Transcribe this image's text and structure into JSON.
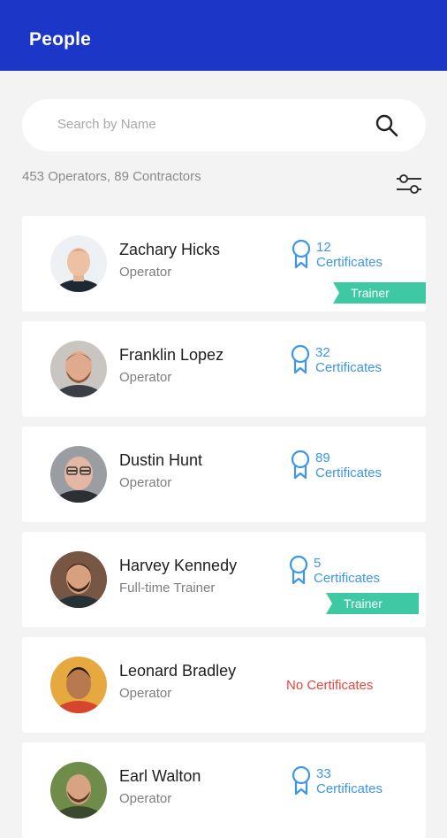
{
  "header": {
    "title": "People"
  },
  "search": {
    "placeholder": "Search by Name",
    "icon": "search-icon"
  },
  "summary": {
    "text": "453 Operators, 89 Contractors",
    "filter_icon": "filter-sliders-icon"
  },
  "colors": {
    "appbar": "#1c36c8",
    "certificate_blue": "#3d96ea",
    "no_cert_red": "#e8443a",
    "trainer_badge": "#3ec9a3"
  },
  "people": [
    {
      "name": "Zachary Hicks",
      "role": "Operator",
      "cert_count": "12",
      "cert_label": "Certificates",
      "badge": "Trainer"
    },
    {
      "name": "Franklin Lopez",
      "role": "Operator",
      "cert_count": "32",
      "cert_label": "Certificates"
    },
    {
      "name": "Dustin Hunt",
      "role": "Operator",
      "cert_count": "89",
      "cert_label": "Certificates"
    },
    {
      "name": "Harvey Kennedy",
      "role": "Full-time Trainer",
      "cert_count": "5",
      "cert_label": "Certificates",
      "badge": "Trainer"
    },
    {
      "name": "Leonard Bradley",
      "role": "Operator",
      "no_cert_text": "No Certificates"
    },
    {
      "name": "Earl Walton",
      "role": "Operator",
      "cert_count": "33",
      "cert_label": "Certificates"
    }
  ]
}
